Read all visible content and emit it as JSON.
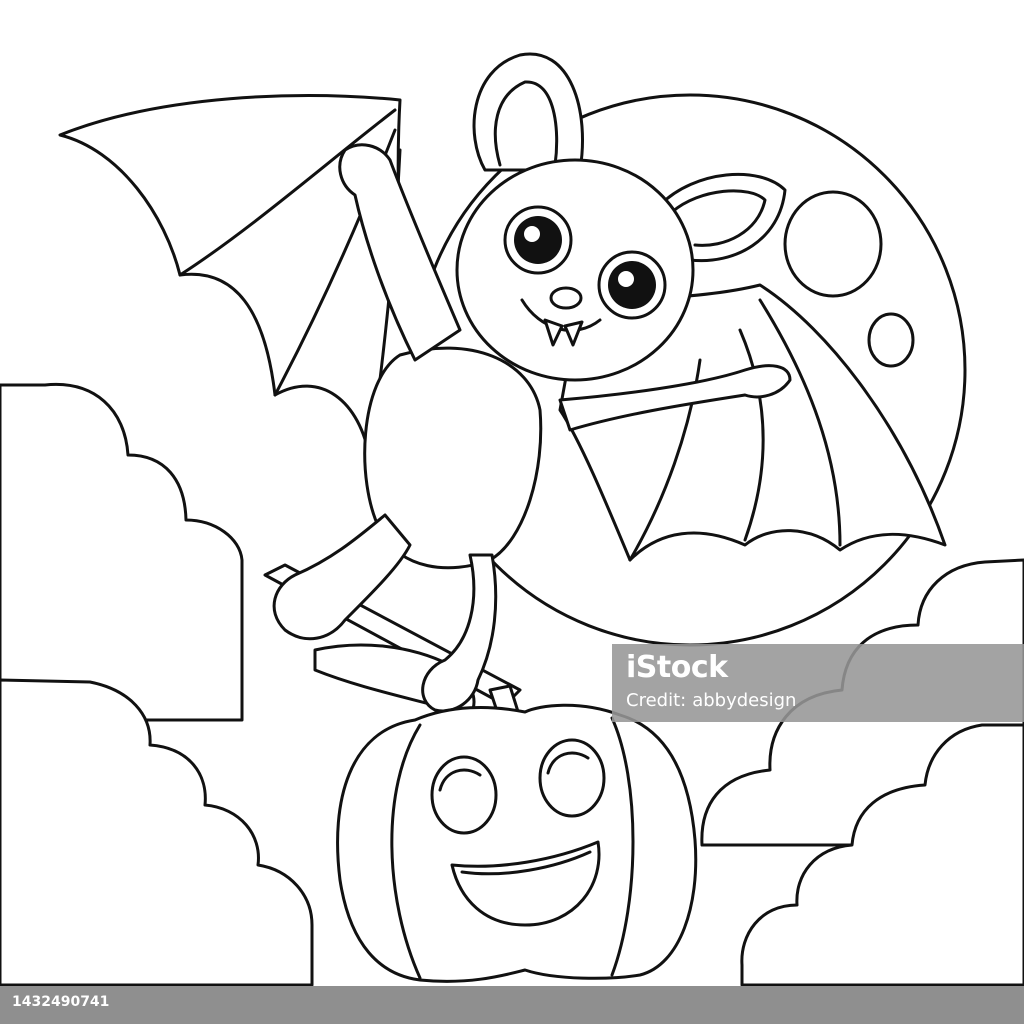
{
  "illustration": {
    "subject": "bat holding pumpkin in front of moon coloring page"
  },
  "watermark": {
    "brand": "iStock",
    "credit_label": "Credit:",
    "credit_name": "abbydesign"
  },
  "footer": {
    "image_id": "1432490741"
  },
  "colors": {
    "line": "#111111",
    "background": "#ffffff",
    "footer_bar": "#8f8f8f",
    "watermark_band": "#969696"
  }
}
